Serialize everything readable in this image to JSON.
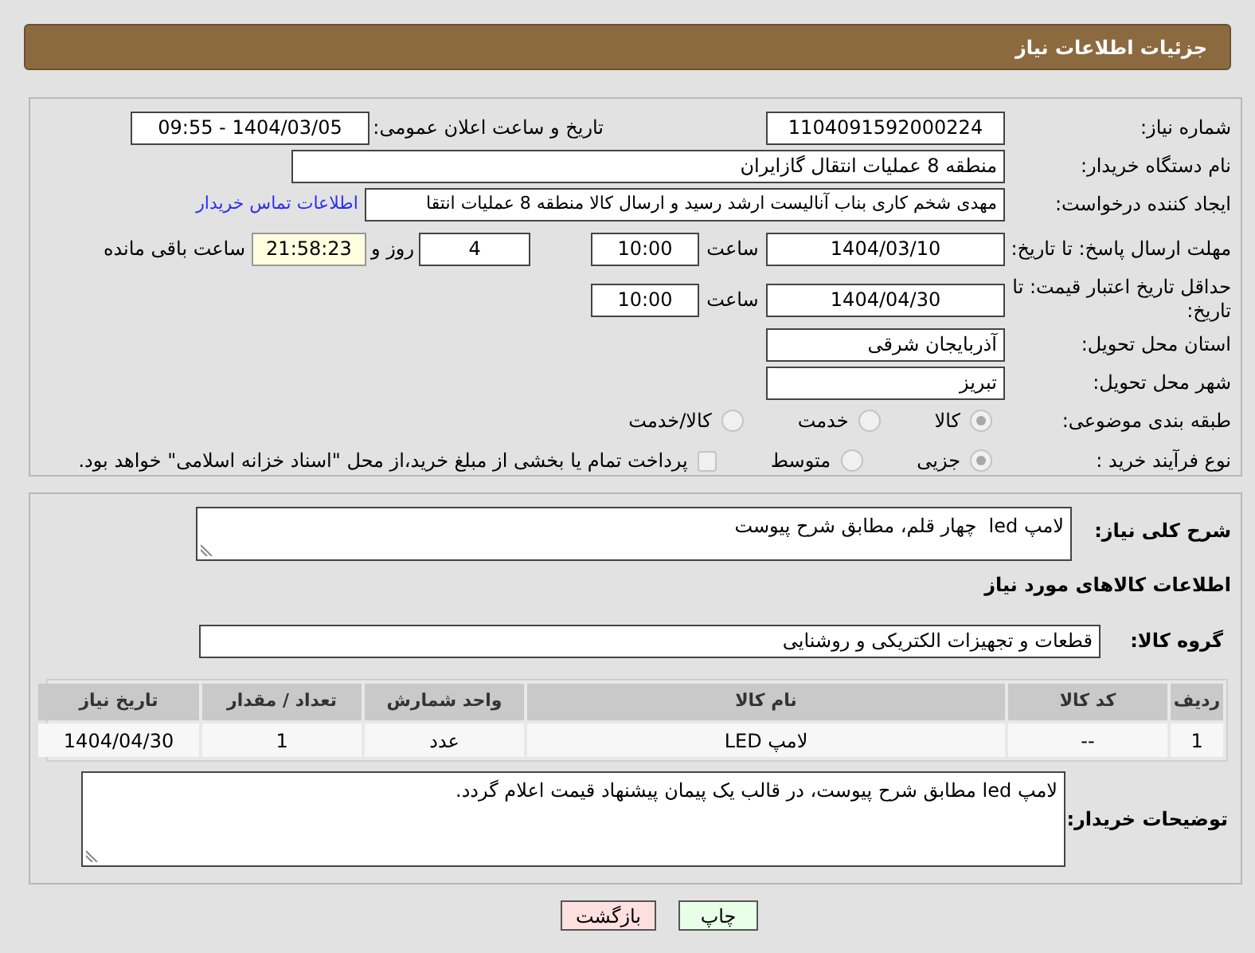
{
  "header": {
    "title": "جزئیات اطلاعات نیاز"
  },
  "details": {
    "need_number": {
      "label": "شماره نیاز:",
      "value": "1104091592000224"
    },
    "announce": {
      "label": "تاریخ و ساعت اعلان عمومی:",
      "value": "1404/03/05 - 09:55"
    },
    "buyer_org": {
      "label": "نام دستگاه خریدار:",
      "value": "منطقه 8 عملیات انتقال گازایران"
    },
    "creator": {
      "label": "ایجاد کننده درخواست:",
      "value": "مهدی شخم کاری بناب آنالیست ارشد رسید و ارسال کالا منطقه 8 عملیات انتقا",
      "contact_link": "اطلاعات تماس خریدار"
    },
    "reply_deadline": {
      "label": "مهلت ارسال پاسخ: تا تاریخ:",
      "date": "1404/03/10",
      "time_label": "ساعت",
      "time": "10:00",
      "days": "4",
      "days_label": "روز و",
      "remaining": "21:58:23",
      "remaining_label": "ساعت باقی مانده"
    },
    "price_validity": {
      "label": "حداقل تاریخ اعتبار قیمت: تا تاریخ:",
      "date": "1404/04/30",
      "time_label": "ساعت",
      "time": "10:00"
    },
    "province": {
      "label": "استان محل تحویل:",
      "value": "آذربایجان شرقی"
    },
    "city": {
      "label": "شهر محل تحویل:",
      "value": "تبریز"
    },
    "category": {
      "label": "طبقه بندی موضوعی:",
      "options": [
        {
          "label": "کالا",
          "selected": true
        },
        {
          "label": "خدمت",
          "selected": false
        },
        {
          "label": "کالا/خدمت",
          "selected": false
        }
      ]
    },
    "purchase_type": {
      "label": "نوع فرآیند خرید :",
      "options": [
        {
          "label": "جزیی",
          "selected": true
        },
        {
          "label": "متوسط",
          "selected": false
        }
      ],
      "treasury": {
        "label": "پرداخت تمام یا بخشی از مبلغ خرید،از محل \"اسناد خزانه اسلامی\" خواهد بود.",
        "checked": false
      }
    }
  },
  "description": {
    "label": "شرح کلی نیاز:",
    "value": "لامپ led  چهار قلم، مطابق شرح پیوست"
  },
  "goods_title": "اطلاعات کالاهای مورد نیاز",
  "goods_group": {
    "label": "گروه کالا:",
    "value": "قطعات و تجهیزات الکتریکی و روشنایی"
  },
  "table": {
    "columns": [
      "ردیف",
      "کد کالا",
      "نام کالا",
      "واحد شمارش",
      "تعداد / مقدار",
      "تاریخ نیاز"
    ],
    "rows": [
      [
        "1",
        "--",
        "لامپ LED",
        "عدد",
        "1",
        "1404/04/30"
      ]
    ]
  },
  "buyer_notes": {
    "label": "توضیحات خریدار:",
    "value": "لامپ led مطابق شرح پیوست، در قالب یک پیمان پیشنهاد قیمت اعلام گردد."
  },
  "buttons": [
    {
      "label": "چاپ",
      "kind": "print"
    },
    {
      "label": "بازگشت",
      "kind": "back"
    }
  ]
}
